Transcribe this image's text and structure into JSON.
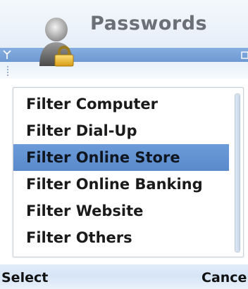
{
  "title": "Passwords",
  "menu": {
    "items": [
      {
        "label": "Filter Computer",
        "selected": false
      },
      {
        "label": "Filter Dial-Up",
        "selected": false
      },
      {
        "label": "Filter Online Store",
        "selected": true
      },
      {
        "label": "Filter Online Banking",
        "selected": false
      },
      {
        "label": "Filter Website",
        "selected": false
      },
      {
        "label": "Filter Others",
        "selected": false
      }
    ]
  },
  "softkeys": {
    "left": "Select",
    "right": "Cancel"
  },
  "icons": {
    "app": "user-lock-icon",
    "signal": "signal-antenna-icon",
    "battery": "battery-icon"
  },
  "colors": {
    "selection": "#5a8acb",
    "status_strip": "#7aa3d9",
    "title_text": "#6b7078"
  }
}
